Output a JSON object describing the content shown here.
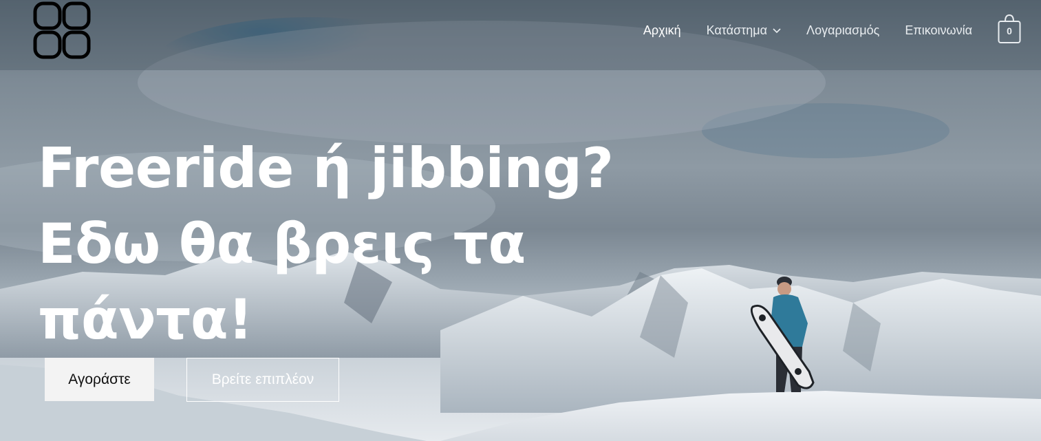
{
  "header": {
    "logo_icon": "four-rounded-squares-logo-icon",
    "nav": [
      {
        "label": "Αρχική",
        "active": true
      },
      {
        "label": "Κατάστημα",
        "has_dropdown": true,
        "dropdown_icon": "chevron-down-icon"
      },
      {
        "label": "Λογαριασμός"
      },
      {
        "label": "Επικοινωνία"
      }
    ],
    "cart": {
      "icon": "shopping-bag-icon",
      "count": "0"
    }
  },
  "hero": {
    "background": "snowy-mountains-with-snowboarder-photo",
    "headline_lines": [
      "Freeride ή jibbing?",
      "Εδω θα βρεις τα",
      "πάντα!"
    ],
    "primary_button": "Αγοράστε",
    "secondary_button": "Βρείτε επιπλέον"
  },
  "colors": {
    "overlay": "#46525f",
    "text": "#ffffff",
    "primary_button_bg": "#f3f3f3",
    "primary_button_text": "#111111"
  }
}
